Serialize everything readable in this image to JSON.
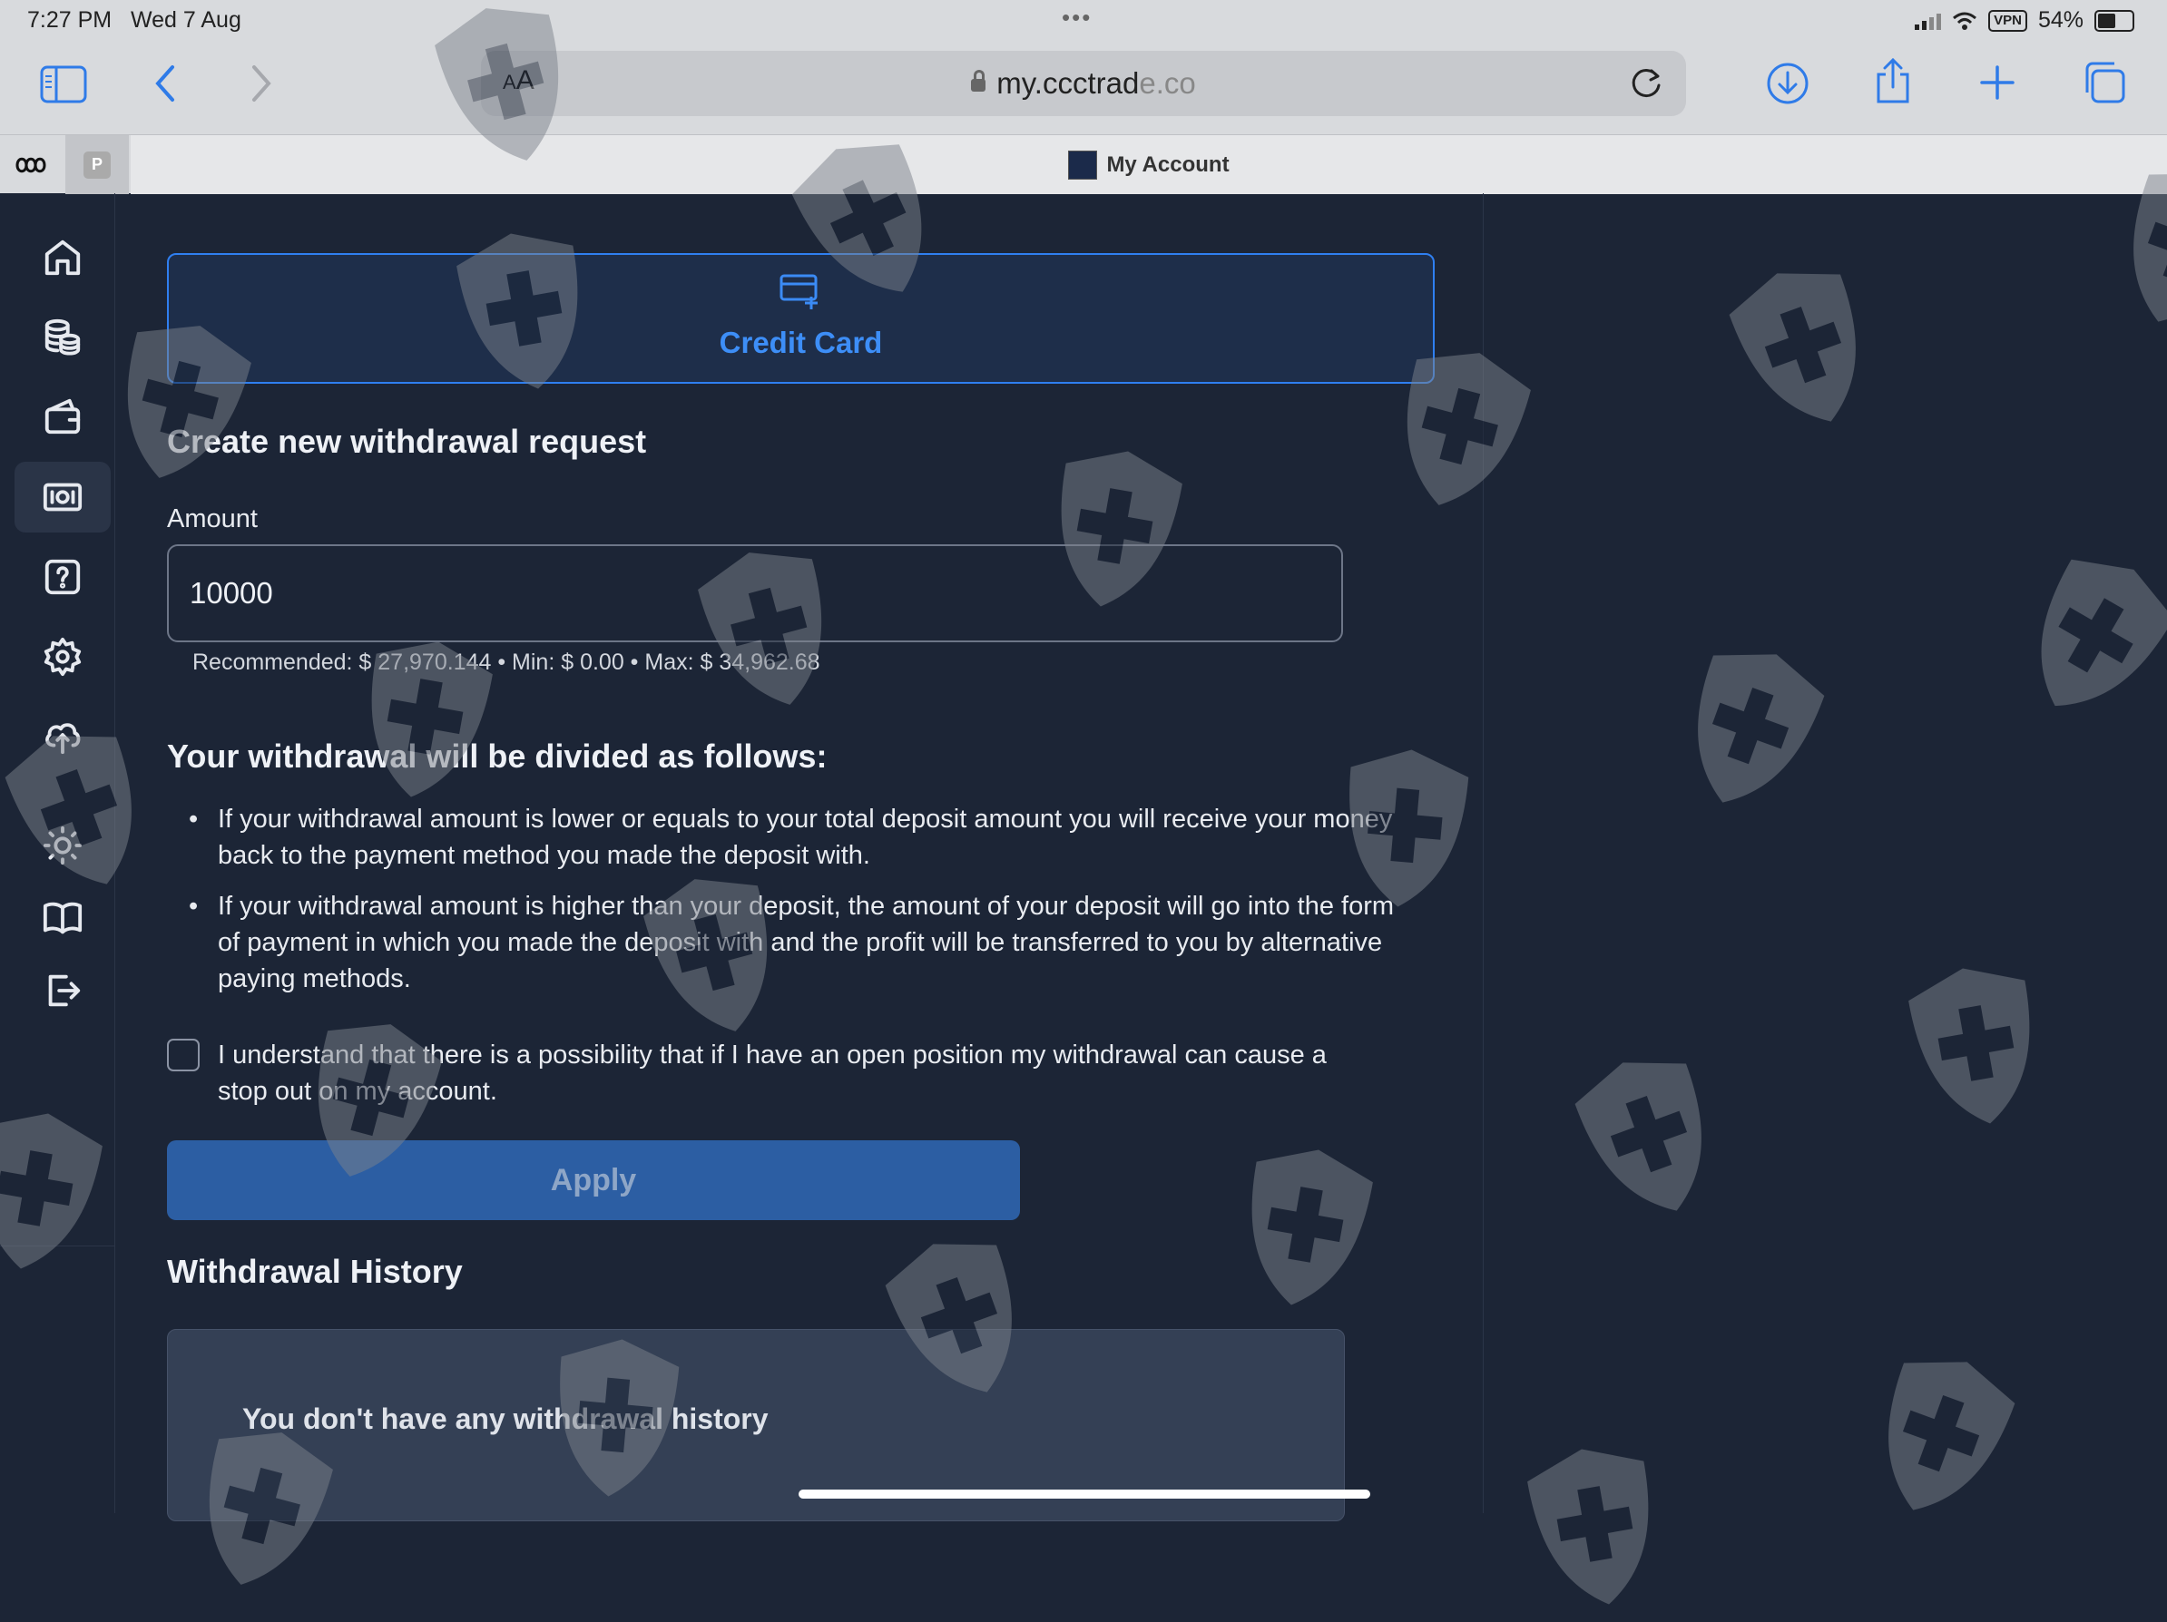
{
  "status_bar": {
    "time": "7:27 PM",
    "date": "Wed 7 Aug",
    "vpn": "VPN",
    "battery": "54%",
    "battery_level": 0.54
  },
  "browser": {
    "text_size_label": "AA",
    "url_main": "my.ccctrad",
    "url_tail": "e.co",
    "tab_p_label": "P",
    "active_tab_title": "My Account"
  },
  "sidebar": {
    "items": [
      {
        "icon": "home-icon"
      },
      {
        "icon": "coins-icon"
      },
      {
        "icon": "wallet-icon"
      },
      {
        "icon": "withdraw-icon",
        "active": true
      },
      {
        "icon": "help-icon"
      },
      {
        "icon": "gear-icon"
      },
      {
        "icon": "upload-icon"
      },
      {
        "icon": "sun-icon"
      },
      {
        "icon": "book-icon"
      },
      {
        "icon": "logout-icon"
      }
    ]
  },
  "main": {
    "method_label": "Credit Card",
    "form_title": "Create new withdrawal request",
    "amount_label": "Amount",
    "amount_value": "10000",
    "amount_hint": "Recommended: $ 27,970.144 • Min: $ 0.00 • Max: $ 34,962.68",
    "division_title": "Your withdrawal will be divided as follows:",
    "rules": [
      "If your withdrawal amount is lower or equals to your total deposit amount you will receive your money back to the payment method you made the deposit with.",
      "If your withdrawal amount is higher than your deposit, the amount of your deposit will go into the form of payment in which you made the deposit with and the profit will be transferred to you by alternative paying methods."
    ],
    "checkbox_label": "I understand that there is a possibility that if I have an open position my withdrawal can cause a stop out on my account.",
    "apply_label": "Apply",
    "history_title": "Withdrawal History",
    "history_empty": "You don't have any withdrawal history"
  },
  "colors": {
    "background": "#1c2536",
    "accent": "#2f7ff0",
    "apply_button": "#2c5ea3",
    "watermark": "#7d838c"
  }
}
